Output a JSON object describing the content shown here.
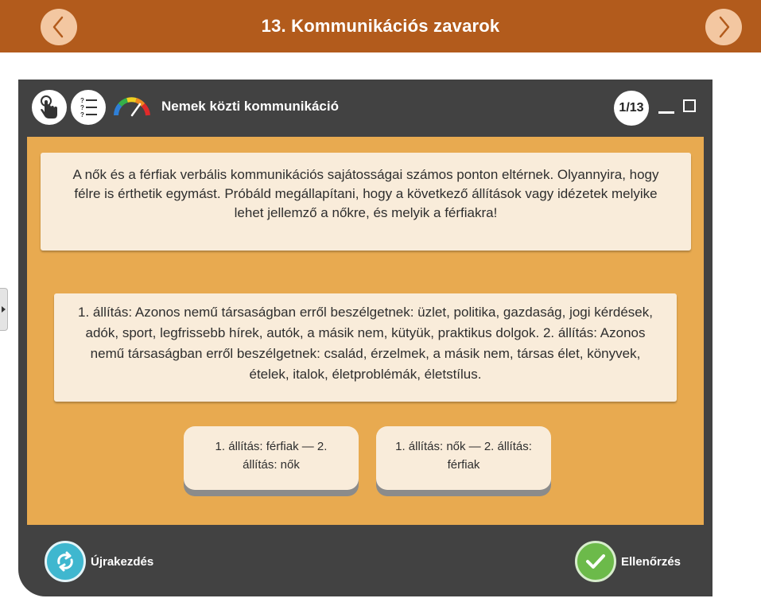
{
  "topbar": {
    "title": "13. Kommunikációs zavarok",
    "prev_icon": "chevron-left-icon",
    "next_icon": "chevron-right-icon",
    "color": "#b25b1c"
  },
  "panel": {
    "title": "Nemek közti kommunikáció",
    "counter": "1/13",
    "icons": [
      "hand-pointer-icon",
      "question-list-icon",
      "difficulty-gauge-icon",
      "minimize-icon",
      "maximize-icon"
    ]
  },
  "content": {
    "instruction": "A nők és a férfiak verbális kommunikációs sajátosságai számos ponton eltérnek. Olyannyira, hogy félre is érthetik egymást. Próbáld megállapítani, hogy a következő állítások vagy idézetek melyike lehet jellemző a nőkre, és melyik a férfiakra!",
    "statement": "1. állítás: Azonos nemű társaságban erről beszélgetnek: üzlet, politika, gazdaság, jogi kérdések, adók, sport, legfrissebb hírek, autók, a másik nem, kütyük, praktikus dolgok. 2. állítás: Azonos nemű társaságban erről beszélgetnek: család, érzelmek, a másik nem, társas élet, könyvek, ételek, italok, életproblémák, életstílus.",
    "choices": [
      "1. állítás: férfiak — 2. állítás: nők",
      "1. állítás: nők — 2. állítás: férfiak"
    ],
    "background": "#e8aa50"
  },
  "footer": {
    "restart_label": "Újrakezdés",
    "check_label": "Ellenőrzés",
    "restart_icon": "refresh-icon",
    "check_icon": "checkmark-icon"
  }
}
